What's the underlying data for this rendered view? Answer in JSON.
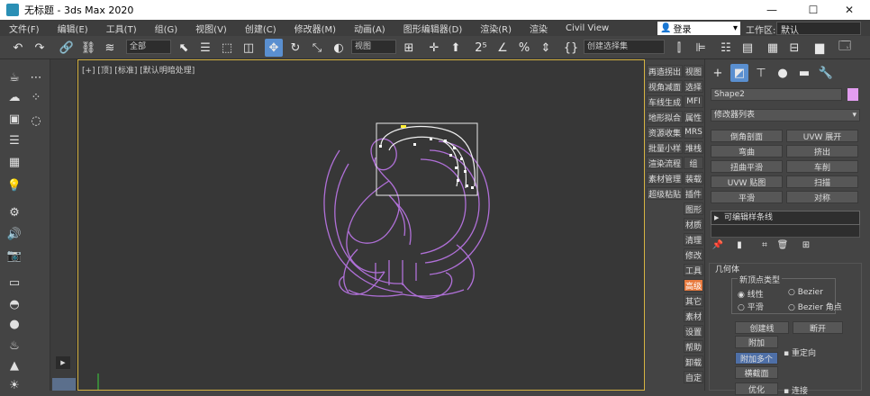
{
  "titlebar": {
    "title": "无标题 - 3ds Max 2020",
    "min": "—",
    "max": "☐",
    "close": "✕"
  },
  "menu": [
    "文件(F)",
    "编辑(E)",
    "工具(T)",
    "组(G)",
    "视图(V)",
    "创建(C)",
    "修改器(M)",
    "动画(A)",
    "图形编辑器(D)",
    "渲染(R)",
    "渲染",
    "Civil View"
  ],
  "signin": {
    "label": "登录"
  },
  "workspace": {
    "label": "工作区:",
    "value": "默认"
  },
  "toolbar": {
    "selection_filter": "全部",
    "view_select": "视图",
    "named_sel": "创建选择集"
  },
  "viewport": {
    "label": "[+] [顶] [标准] [默认明暗处理]"
  },
  "quick": {
    "col1": [
      "再造拐出",
      "视角减面",
      "车线生成",
      "地形拟合",
      "资源收集",
      "批量小样",
      "渲染流程",
      "素材管理",
      "超级粘贴"
    ],
    "col2": [
      "视图",
      "选择",
      "MFI",
      "属性",
      "MRS",
      "堆栈",
      "组",
      "装载",
      "插件",
      "图形",
      "材质",
      "清理",
      "修改",
      "工具",
      "高级",
      "其它",
      "素材",
      "设置",
      "帮助",
      "卸载",
      "自定"
    ],
    "highlight": "高级"
  },
  "cmd": {
    "object_name": "Shape2",
    "modifier_list": "修改器列表",
    "buttons": [
      "倒角剖面",
      "UVW 展开",
      "弯曲",
      "挤出",
      "扭曲平滑",
      "车削",
      "UVW 贴图",
      "扫描",
      "平滑",
      "对称"
    ],
    "stack_item": "可编辑样条线",
    "group_new_vertex": "新顶点类型",
    "radio_linear": "线性",
    "radio_bezier": "Bezier",
    "radio_smooth": "平滑",
    "radio_bezier_corner": "Bezier 角点",
    "btn_create_line": "创建线",
    "btn_break": "断开",
    "btn_attach": "附加",
    "btn_attach_multi": "附加多个",
    "chk_reorient": "重定向",
    "btn_cross_section": "横截面",
    "btn_refine": "优化",
    "chk_connect": "连接",
    "rollout_geometry": "几何体"
  }
}
